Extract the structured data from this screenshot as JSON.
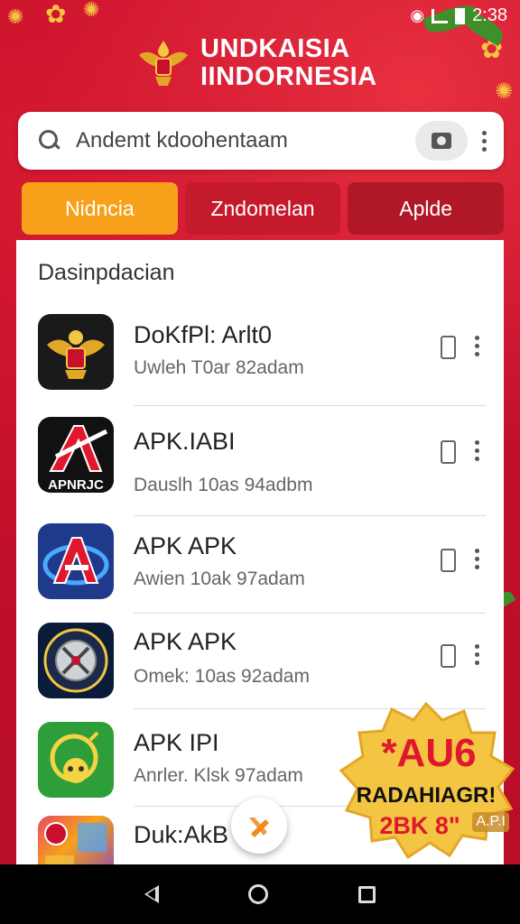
{
  "status_bar": {
    "time": "2:38"
  },
  "header": {
    "title_line1": "UNDKAISIA",
    "title_line2": "IINDORNESIA"
  },
  "search": {
    "placeholder": "Andemt kdoohentaam"
  },
  "tabs": [
    {
      "label": "Nidncia",
      "active": true
    },
    {
      "label": "Zndomelan",
      "active": false
    },
    {
      "label": "Aplde",
      "active": false
    }
  ],
  "section": {
    "title": "Dasinpdacian"
  },
  "apps": [
    {
      "name": "DoKfPl: Arlt0",
      "subtitle": "Uwleh T0ar 82adam",
      "icon": "garuda-emblem-icon",
      "icon_bg": "#1a1a1a"
    },
    {
      "name": "APK.IABI",
      "subtitle": "Dauslh 10as 94adbm",
      "icon": "apk-a-logo-icon",
      "icon_label": "APNRJC",
      "icon_bg": "#111111"
    },
    {
      "name": "APK APK",
      "subtitle": "Awien 10ak 97adam",
      "icon": "blue-a-logo-icon",
      "icon_bg": "#1f3a8a"
    },
    {
      "name": "APK APK",
      "subtitle": "Omek: 10as 92adam",
      "icon": "compass-badge-icon",
      "icon_bg": "#0b1b3a"
    },
    {
      "name": "APK IPI",
      "subtitle": "Anrler. Klsk 97adam",
      "icon": "monkey-logo-icon",
      "icon_bg": "#2e9e3a"
    },
    {
      "name": "Duk:AkB",
      "subtitle": "",
      "icon": "colorful-grid-icon",
      "icon_bg": "#7b3fc9"
    }
  ],
  "promo": {
    "line1": "*AU6",
    "line2": "RADAHIAGR!",
    "line3": "2BK 8\"",
    "line4": "A.P.I"
  },
  "colors": {
    "brand_red": "#c8102e",
    "tab_active": "#f7a11a",
    "fab_icon": "#f08a1c"
  }
}
